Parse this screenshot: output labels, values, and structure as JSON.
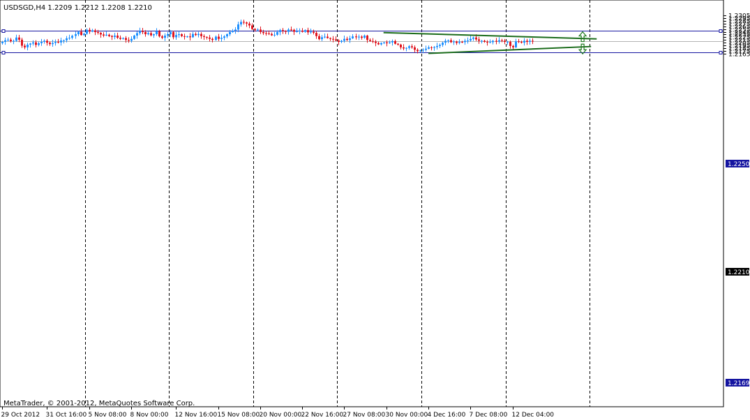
{
  "header": {
    "symbol_info": "USDSGD,H4  1.2209 1.2212 1.2208 1.2210"
  },
  "footer": {
    "copyright": "MetaTrader, © 2001-2012, MetaQuotes Software Corp."
  },
  "colors": {
    "bull": "#1e90ff",
    "bear": "#e0141e",
    "hline": "#1414a0",
    "trend": "#1a6b1a",
    "current_line": "#b4b4b4"
  },
  "levels": {
    "upper": "1.2250",
    "lower": "1.2169",
    "current": "1.2210"
  },
  "icons": [
    "up-arrow-icon",
    "down-arrow-icon"
  ],
  "chart_data": {
    "type": "candlestick",
    "symbol": "USDSGD",
    "timeframe": "H4",
    "ylim": [
      1.216,
      1.231
    ],
    "y_ticks": [
      "1.2305",
      "1.2295",
      "1.2285",
      "1.2275",
      "1.2265",
      "1.2255",
      "1.2245",
      "1.2235",
      "1.2225",
      "1.2215",
      "1.2205",
      "1.2195",
      "1.2185",
      "1.2175",
      "1.2165"
    ],
    "x_labels": [
      "29 Oct 2012",
      "31 Oct 16:00",
      "5 Nov 08:00",
      "8 Nov 00:00",
      "12 Nov 16:00",
      "15 Nov 08:00",
      "20 Nov 00:00",
      "22 Nov 16:00",
      "27 Nov 08:00",
      "30 Nov 00:00",
      "4 Dec 16:00",
      "7 Dec 08:00",
      "12 Dec 04:00"
    ],
    "x_label_bars": [
      0,
      16,
      31,
      46,
      62,
      77,
      92,
      107,
      122,
      137,
      152,
      167,
      182
    ],
    "period_separators_at_bar": [
      29.5,
      59.5,
      89.5,
      119.5,
      149.5,
      179.5,
      209.5
    ],
    "horizontal_lines": [
      1.225,
      1.2169
    ],
    "current_price": 1.221,
    "trendlines": [
      {
        "from": [
          136,
          1.2242
        ],
        "to": [
          212,
          1.2219
        ]
      },
      {
        "from": [
          152,
          1.2166
        ],
        "to": [
          210,
          1.2191
        ]
      }
    ],
    "arrows": [
      {
        "direction": "up",
        "bar": 207,
        "price": 1.2227
      },
      {
        "direction": "down",
        "bar": 207,
        "price": 1.2182
      }
    ],
    "close": [
      1.2208,
      1.2214,
      1.2216,
      1.2211,
      1.2212,
      1.2224,
      1.2216,
      1.2194,
      1.2188,
      1.2198,
      1.2202,
      1.2206,
      1.2197,
      1.2203,
      1.2208,
      1.2212,
      1.2205,
      1.22,
      1.2204,
      1.2208,
      1.2206,
      1.2213,
      1.2214,
      1.2221,
      1.2223,
      1.223,
      1.2236,
      1.2245,
      1.2233,
      1.2238,
      1.2252,
      1.2246,
      1.225,
      1.2244,
      1.2241,
      1.2235,
      1.2231,
      1.2234,
      1.2229,
      1.2226,
      1.2231,
      1.2223,
      1.2219,
      1.2222,
      1.2215,
      1.2212,
      1.2219,
      1.2231,
      1.224,
      1.2248,
      1.2244,
      1.2236,
      1.224,
      1.2232,
      1.2236,
      1.2247,
      1.2228,
      1.2223,
      1.2231,
      1.2236,
      1.2244,
      1.2225,
      1.2233,
      1.2236,
      1.2229,
      1.2227,
      1.2228,
      1.2225,
      1.2237,
      1.2233,
      1.2237,
      1.2229,
      1.2226,
      1.2224,
      1.2219,
      1.2215,
      1.2227,
      1.2219,
      1.2223,
      1.2228,
      1.2236,
      1.2244,
      1.2249,
      1.2253,
      1.2272,
      1.2281,
      1.2279,
      1.2275,
      1.2268,
      1.2255,
      1.2251,
      1.2253,
      1.2244,
      1.224,
      1.2239,
      1.2237,
      1.2232,
      1.2234,
      1.2244,
      1.2251,
      1.2248,
      1.2245,
      1.2253,
      1.2252,
      1.2245,
      1.2247,
      1.2249,
      1.2245,
      1.2251,
      1.2243,
      1.2245,
      1.2241,
      1.2229,
      1.2218,
      1.2225,
      1.2227,
      1.2222,
      1.2219,
      1.2217,
      1.2213,
      1.2208,
      1.2212,
      1.2219,
      1.2215,
      1.2221,
      1.2228,
      1.2225,
      1.2227,
      1.2223,
      1.2231,
      1.2215,
      1.2211,
      1.2209,
      1.2204,
      1.2199,
      1.2204,
      1.2206,
      1.2203,
      1.2206,
      1.2211,
      1.2201,
      1.2198,
      1.2188,
      1.2184,
      1.2186,
      1.2192,
      1.2188,
      1.2179,
      1.2174,
      1.2177,
      1.2179,
      1.2183,
      1.2188,
      1.2186,
      1.2189,
      1.2193,
      1.2197,
      1.2205,
      1.2212,
      1.2214,
      1.2207,
      1.2209,
      1.2204,
      1.2208,
      1.2207,
      1.2212,
      1.2213,
      1.2219,
      1.2224,
      1.2217,
      1.2212,
      1.2212,
      1.2208,
      1.2206,
      1.2207,
      1.2212,
      1.2209,
      1.2214,
      1.2212,
      1.2208,
      1.2208,
      1.2193,
      1.2188,
      1.221,
      1.2208,
      1.2205,
      1.2212,
      1.2208,
      1.2212,
      1.221
    ]
  }
}
